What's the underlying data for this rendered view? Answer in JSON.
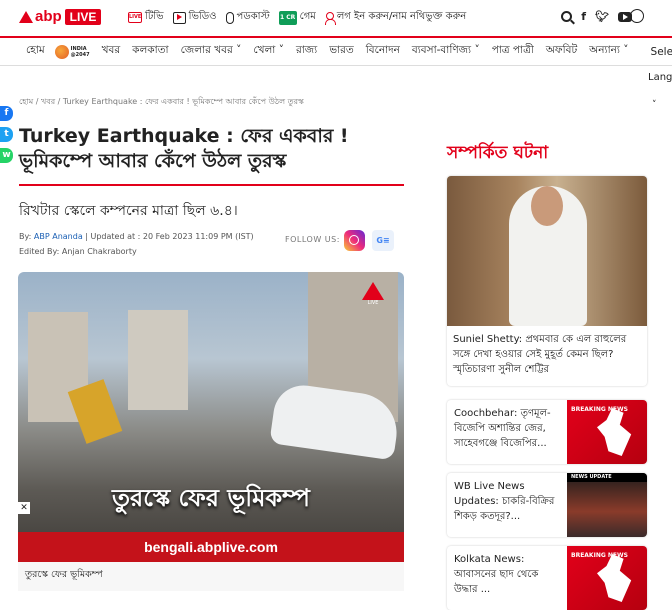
{
  "header": {
    "logo_text": "abp",
    "live_label": "LIVE",
    "nav": [
      {
        "icon": "tv-icon",
        "label": "টিভি"
      },
      {
        "icon": "video-icon",
        "label": "ভিডিও"
      },
      {
        "icon": "podcast-icon",
        "label": "পডকাস্ট"
      },
      {
        "icon": "crorepati-icon",
        "label": "গেম"
      },
      {
        "icon": "user-icon",
        "label": "লগ ইন করুন/নাম নথিভুক্ত করুন"
      }
    ],
    "social_icons": [
      "search-icon",
      "facebook-icon",
      "twitter-icon",
      "youtube-icon",
      "language-icon"
    ]
  },
  "navbar": {
    "items": [
      "হোম",
      "খবর",
      "কলকাতা",
      "জেলার খবর ˅",
      "খেলা ˅",
      "রাজ্য",
      "ভারত",
      "বিনোদন",
      "ব্যবসা-বাণিজ্য ˅",
      "পাত্র পাত্রী",
      "অফবিট",
      "অন্যান্য ˅"
    ],
    "badge_line1": "INDIA",
    "badge_line2": "@2047",
    "select_label": "Selec",
    "lang_label": "Lang"
  },
  "article": {
    "breadcrumb": "হোম / খবর / Turkey Earthquake : ফের একবার ! ভূমিকম্পে আবার কেঁপে উঠল তুরস্ক",
    "headline": "Turkey Earthquake : ফের একবার ! ভূমিকম্পে আবার কেঁপে উঠল তুরস্ক",
    "subhead": "রিখটার স্কেলে কম্পনের মাত্রা ছিল ৬.৪।",
    "by_prefix": "By: ",
    "author": "ABP Ananda",
    "updated": " | Updated at : 20 Feb 2023 11:09 PM (IST)",
    "edited_by": "Edited By: Anjan Chakraborty",
    "follow_label": "FOLLOW US:",
    "image_overlay": "তুরস্কে ফের ভূমিকম্প",
    "image_watermark": "bengali.abplive.com",
    "image_caption": "তুরস্কে ফের ভূমিকম্প"
  },
  "share": [
    "f",
    "t",
    "w"
  ],
  "related": {
    "title": "সম্পর্কিত ঘটনা",
    "featured": "Suniel Shetty: প্রথমবার কে এল রাহুলের সঙ্গে দেখা হওয়ার সেই মুহূর্ত কেমন ছিল? স্মৃতিচারণা সুনীল শেট্টির",
    "cards": [
      {
        "text": "Coochbehar: তৃণমূল-বিজেপি অশান্তির জের, সাহেবগঞ্জে বিজেপির...",
        "thumb_label": "BREAKING NEWS"
      },
      {
        "text": "WB Live News Updates: চাকরি-বিক্রির শিকড় কতদূর?...",
        "thumb_label": "NEWS UPDATE"
      },
      {
        "text": "Kolkata News: আবাসনের ছাদ থেকে উদ্ধার ...",
        "thumb_label": "BREAKING NEWS"
      }
    ]
  },
  "colors": {
    "brand": "#e2001a",
    "link": "#1a5fb4"
  }
}
